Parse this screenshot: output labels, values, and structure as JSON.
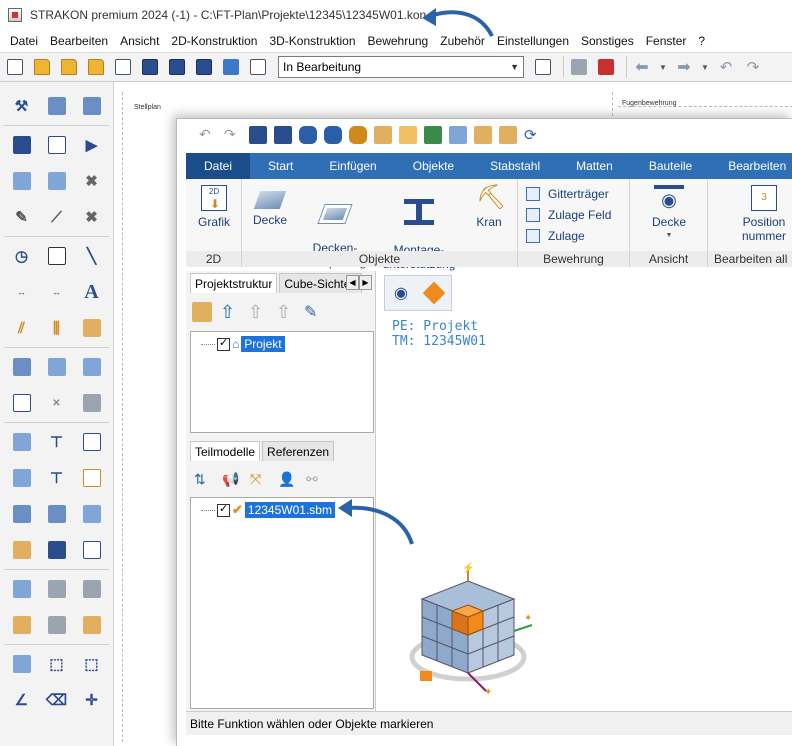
{
  "window": {
    "title": "STRAKON premium 2024 (-1) - C:\\FT-Plan\\Projekte\\12345\\12345W01.kon"
  },
  "menubar": {
    "items": [
      "Datei",
      "Bearbeiten",
      "Ansicht",
      "2D-Konstruktion",
      "3D-Konstruktion",
      "Bewehrung",
      "Zubehör",
      "Einstellungen",
      "Sonstiges",
      "Fenster",
      "?"
    ]
  },
  "toolbar": {
    "status_value": "In Bearbeitung"
  },
  "canvas": {
    "left_label": "Stellplan",
    "right_label": "Fugenbewehrung"
  },
  "ribbon": {
    "tabs": [
      "Datei",
      "Start",
      "Einfügen",
      "Objekte",
      "Stabstahl",
      "Matten",
      "Bauteile",
      "Bearbeiten"
    ],
    "groups": {
      "g2d": {
        "label": "2D",
        "grafik": "Grafik",
        "grafik_icon_text": "2D"
      },
      "objekte": {
        "label": "Objekte",
        "decke": "Decke",
        "aussparung": "Decken-\naussparung",
        "montage": "Montage-\nunterstützung",
        "kran": "Kran"
      },
      "bewehrung": {
        "label": "Bewehrung",
        "gittertraeger": "Gitterträger",
        "zulage_feld": "Zulage Feld",
        "zulage": "Zulage"
      },
      "ansicht": {
        "label": "Ansicht",
        "decke": "Decke"
      },
      "bearbeiten": {
        "label": "Bearbeiten all",
        "position": "Position",
        "nummer": "nummer"
      }
    }
  },
  "left_pane": {
    "tabs_top": [
      "Projektstruktur",
      "Cube-Sichten"
    ],
    "tree_top": {
      "node": "Projekt"
    },
    "tabs_bottom": [
      "Teilmodelle",
      "Referenzen"
    ],
    "tree_bottom": {
      "node": "12345W01.sbm"
    }
  },
  "view": {
    "pe_line": "PE: Projekt",
    "tm_line": "TM: 12345W01"
  },
  "statusbar": {
    "text": "Bitte Funktion wählen oder Objekte markieren"
  },
  "colors": {
    "ribbon_blue": "#2e6fb5",
    "ribbon_active": "#1b4d8a",
    "selection": "#1e73d8",
    "arrow": "#2a64a8",
    "cube_orange": "#f08a1c"
  }
}
